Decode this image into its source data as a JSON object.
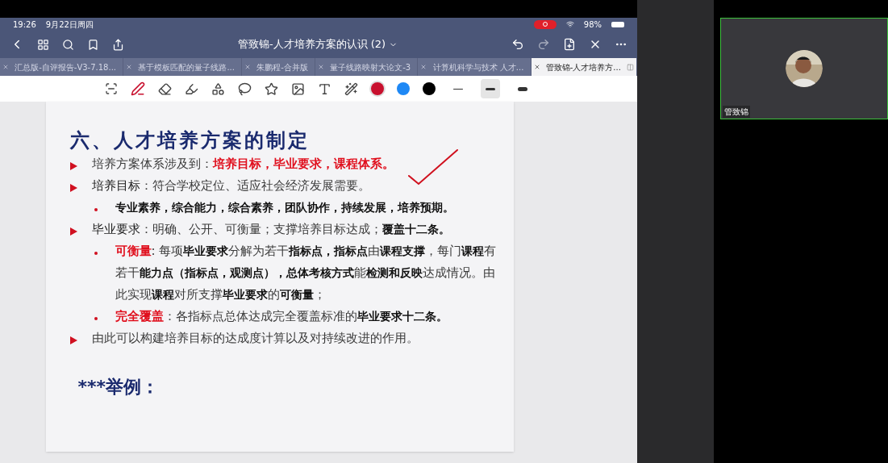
{
  "status_bar": {
    "time": "19:26",
    "date": "9月22日周四",
    "battery": "98%",
    "recording": true
  },
  "document": {
    "title": "管致锦-人才培养方案的认识 (2)"
  },
  "tabs": [
    {
      "label": "汇总版-自评报告-V3-7.18...",
      "selected": false
    },
    {
      "label": "基于模板匹配的量子线路...",
      "selected": false
    },
    {
      "label": "朱鹏程-合并版",
      "selected": false
    },
    {
      "label": "量子线路映射大论文-3",
      "selected": false
    },
    {
      "label": "计算机科学与技术 人才...",
      "selected": false
    },
    {
      "label": "管致锦-人才培养方...",
      "selected": true
    }
  ],
  "pen_colors": [
    {
      "color": "#c8102e",
      "selected": true
    },
    {
      "color": "#1e88f5",
      "selected": false
    },
    {
      "color": "#000000",
      "selected": false
    }
  ],
  "stroke_widths": [
    {
      "kind": "thin",
      "selected": false
    },
    {
      "kind": "medium",
      "selected": true
    },
    {
      "kind": "thick",
      "selected": false
    }
  ],
  "slide": {
    "heading": "六、人才培养方案的制定",
    "bullets": [
      {
        "kind": "arrow",
        "segments": [
          {
            "kind": "normal",
            "text": "培养方案体系涉及到："
          },
          {
            "kind": "red",
            "text": "培养目标，毕业要求，课程体系。"
          }
        ]
      },
      {
        "kind": "arrow",
        "segments": [
          {
            "kind": "dark",
            "text": "培养目标"
          },
          {
            "kind": "normal",
            "text": "：符合学校定位、适应社会经济发展需要。"
          }
        ]
      },
      {
        "kind": "dot",
        "segments": [
          {
            "kind": "bold",
            "text": "专业素养，综合能力，综合素养，团队协作，持续发展，培养预期。"
          }
        ]
      },
      {
        "kind": "arrow",
        "segments": [
          {
            "kind": "dark",
            "text": "毕业要求"
          },
          {
            "kind": "normal",
            "text": "：明确、公开、可衡量；支撑培养目标达成；"
          },
          {
            "kind": "bold",
            "text": "覆盖十二条。"
          }
        ]
      },
      {
        "kind": "dot",
        "segments": [
          {
            "kind": "red",
            "text": "可衡量"
          },
          {
            "kind": "normal",
            "text": ": 每项"
          },
          {
            "kind": "bold",
            "text": "毕业要求"
          },
          {
            "kind": "normal",
            "text": "分解为若干"
          },
          {
            "kind": "bold",
            "text": "指标点，指标点"
          },
          {
            "kind": "normal",
            "text": "由"
          },
          {
            "kind": "bold",
            "text": "课程支撑"
          },
          {
            "kind": "normal",
            "text": "，每门"
          },
          {
            "kind": "bold",
            "text": "课程"
          },
          {
            "kind": "normal",
            "text": "有若干"
          },
          {
            "kind": "bold",
            "text": "能力点（指标点，观测点），总体考核方式"
          },
          {
            "kind": "normal",
            "text": "能"
          },
          {
            "kind": "bold",
            "text": "检测和反映"
          },
          {
            "kind": "normal",
            "text": "达成情况。由此实现"
          },
          {
            "kind": "bold",
            "text": "课程"
          },
          {
            "kind": "normal",
            "text": "对所支撑"
          },
          {
            "kind": "bold",
            "text": "毕业要求"
          },
          {
            "kind": "normal",
            "text": "的"
          },
          {
            "kind": "bold",
            "text": "可衡量"
          },
          {
            "kind": "normal",
            "text": "；"
          }
        ]
      },
      {
        "kind": "dot",
        "segments": [
          {
            "kind": "red",
            "text": "完全覆盖"
          },
          {
            "kind": "normal",
            "text": "：各指标点总体达成完全覆盖标准的"
          },
          {
            "kind": "bold",
            "text": "毕业要求十二条。"
          }
        ]
      },
      {
        "kind": "arrow",
        "segments": [
          {
            "kind": "normal",
            "text": "由此可以构建培养目标的达成度计算以及对持续改进的作用。"
          }
        ]
      }
    ],
    "example": "***举例："
  },
  "participant": {
    "name": "管致锦",
    "speaking": true
  }
}
